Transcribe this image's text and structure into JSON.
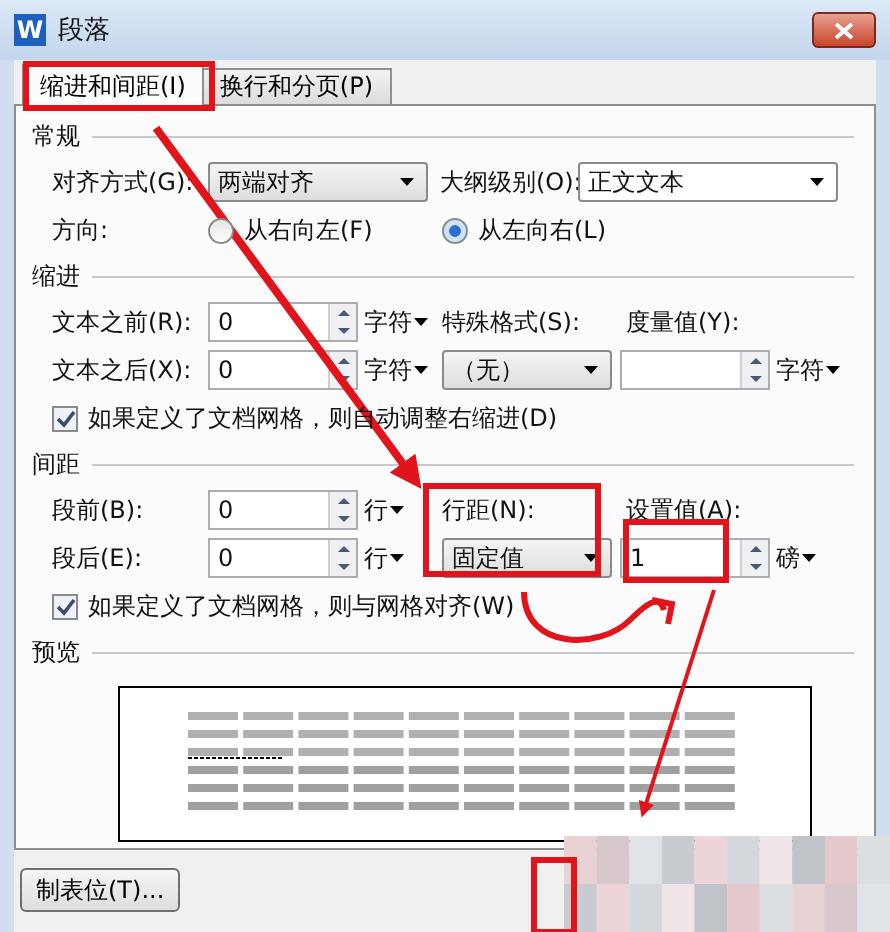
{
  "window": {
    "title": "段落",
    "app_icon_letter": "W"
  },
  "tabs": [
    {
      "label": "缩进和间距(I)",
      "selected": true
    },
    {
      "label": "换行和分页(P)",
      "selected": false
    }
  ],
  "general": {
    "heading": "常规",
    "alignment": {
      "label": "对齐方式(G):",
      "value": "两端对齐"
    },
    "outline_level": {
      "label": "大纲级别(O):",
      "value": "正文文本"
    },
    "direction": {
      "label": "方向:",
      "options": [
        {
          "label": "从右向左(F)",
          "selected": false
        },
        {
          "label": "从左向右(L)",
          "selected": true
        }
      ]
    }
  },
  "indent": {
    "heading": "缩进",
    "before": {
      "label": "文本之前(R):",
      "value": "0",
      "unit": "字符"
    },
    "after": {
      "label": "文本之后(X):",
      "value": "0",
      "unit": "字符"
    },
    "special": {
      "label": "特殊格式(S):",
      "value": "（无）"
    },
    "measure": {
      "label": "度量值(Y):",
      "unit": "字符"
    },
    "auto_adjust": {
      "label": "如果定义了文档网格，则自动调整右缩进(D)",
      "checked": true
    }
  },
  "spacing": {
    "heading": "间距",
    "before": {
      "label": "段前(B):",
      "value": "0",
      "unit": "行"
    },
    "after": {
      "label": "段后(E):",
      "value": "0",
      "unit": "行"
    },
    "line_spacing": {
      "label": "行距(N):",
      "value": "固定值"
    },
    "set_value": {
      "label": "设置值(A):",
      "value": "1",
      "unit": "磅"
    },
    "snap_to_grid": {
      "label": "如果定义了文档网格，则与网格对齐(W)",
      "checked": true
    }
  },
  "preview": {
    "heading": "预览"
  },
  "buttons": [
    {
      "label": "制表位(T)..."
    }
  ]
}
